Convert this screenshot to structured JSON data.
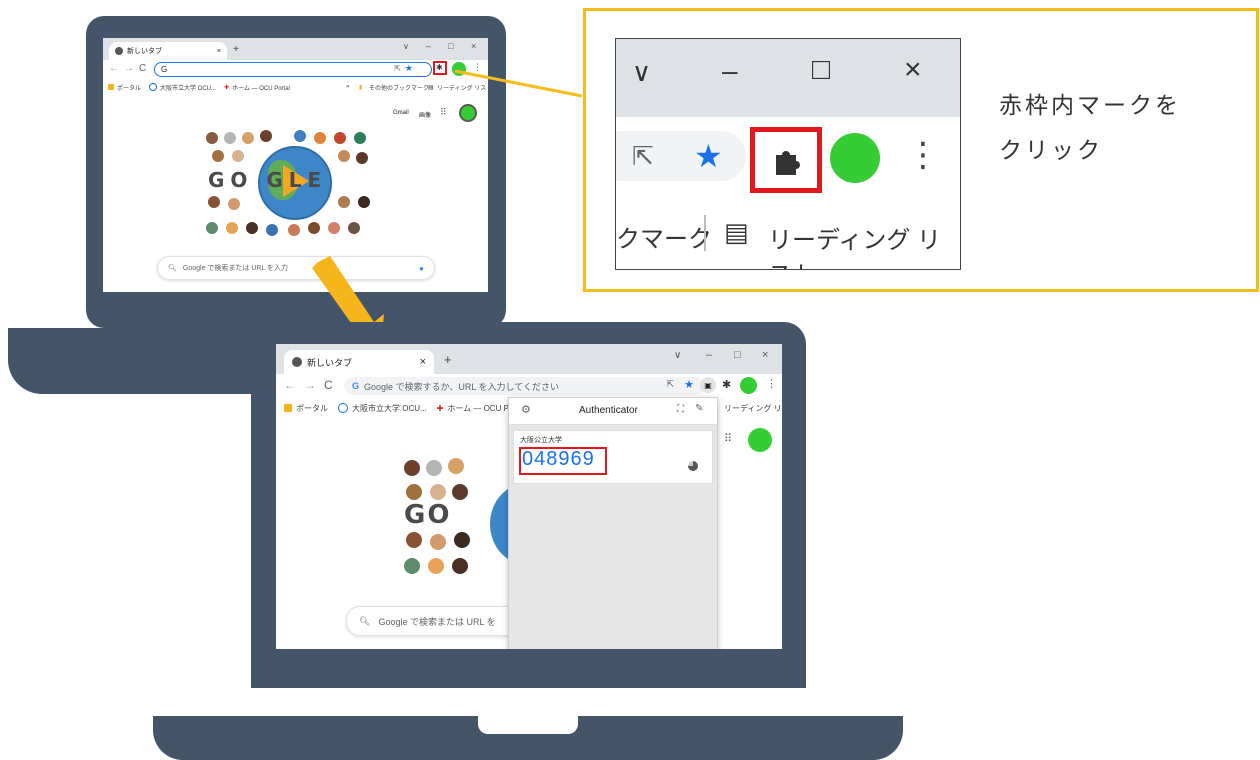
{
  "colors": {
    "laptop": "#44556a",
    "callout_border": "#f5bd1a",
    "arrow": "#f5b51b",
    "highlight": "#e0191f",
    "avatar": "#35cc35",
    "code": "#1a73e8"
  },
  "top_browser": {
    "tab_title": "新しいタブ",
    "tab_close": "×",
    "new_tab": "+",
    "window_buttons": [
      "∨",
      "–",
      "□",
      "×"
    ],
    "omnibox_text": "G",
    "bookmarks": [
      "ポータル",
      "大阪市立大学 OCU...",
      "ホーム — OCU Portal"
    ],
    "bookmarks_more": "»",
    "other_bookmarks": "その他のブックマーク",
    "reading_list": "リーディング リスト",
    "header_links": [
      "Gmail",
      "画像"
    ],
    "doodle_letters": "GO GLE",
    "search_placeholder": "Google で検索または URL を入力"
  },
  "callout": {
    "window_buttons": [
      "∨",
      "–",
      "□",
      "×"
    ],
    "bookmark_fragment": "クマーク",
    "reading_list": "リーディング リスト",
    "instruction_line1": "赤枠内マークを",
    "instruction_line2": "クリック"
  },
  "bottom_browser": {
    "tab_title": "新しいタブ",
    "tab_close": "×",
    "new_tab": "+",
    "window_buttons": [
      "∨",
      "–",
      "□",
      "×"
    ],
    "omnibox_text": "Google で検索するか、URL を入力してください",
    "bookmarks": [
      "ポータル",
      "大阪市立大学 OCU...",
      "ホーム — OCU Portal"
    ],
    "reading_list": "リーディング リスト",
    "search_placeholder": "Google で検索または URL を",
    "doodle_letters": "GO",
    "authenticator": {
      "title": "Authenticator",
      "account_name": "大阪公立大学",
      "code": "048969"
    }
  },
  "icons": {
    "extension": "puzzle-icon",
    "share": "share-icon",
    "bookmark_star": "star-icon",
    "menu": "kebab-menu-icon",
    "apps": "apps-grid-icon",
    "settings": "gear-icon",
    "scan": "scan-qr-icon",
    "edit": "pencil-icon",
    "timer": "timer-pie-icon",
    "mic": "microphone-icon",
    "search": "search-icon",
    "reload": "reload-icon"
  }
}
